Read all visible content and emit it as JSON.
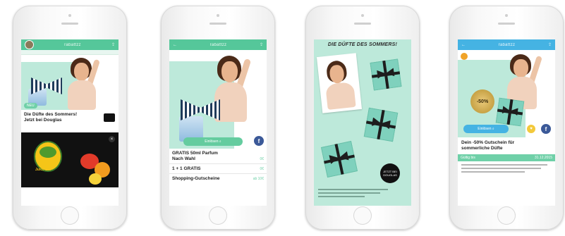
{
  "phones": [
    {
      "appbar_title": "rabattzz",
      "caption_line1": "Die Düfte des Sommers!",
      "caption_line2": "Jetzt bei Douglas",
      "badge": "NEU",
      "logo_text": "Juice Bar"
    },
    {
      "appbar_title": "rabattzz",
      "button_label": "Einlösen",
      "rows": [
        {
          "label": "GRATIS 50ml Parfum",
          "label2": "Nach Wahl",
          "price": "0€"
        },
        {
          "label": "1 + 1 GRATIS",
          "price": "0€"
        },
        {
          "label": "Shopping-Gutscheine",
          "price": "ab 10€"
        }
      ]
    },
    {
      "banner": "DIE DÜFTE DES SOMMERS!",
      "badge_text": "JETZT BEI DOUGLAS"
    },
    {
      "appbar_title": "rabattzz",
      "discount_badge": "-50%",
      "button_label": "Einlösen",
      "caption_line1": "Dein -50% Gutschein für",
      "caption_line2": "sommerliche Düfte",
      "valid_label": "Gültig bis",
      "valid_date": "31.12.2015"
    }
  ],
  "colors": {
    "mint": "#bde9da",
    "green": "#55c79a",
    "blue": "#45b3e3",
    "facebook": "#3b5998"
  },
  "icons": [
    "avatar",
    "back-arrow-icon",
    "share-icon",
    "facebook-icon",
    "heart-icon",
    "search-icon"
  ]
}
